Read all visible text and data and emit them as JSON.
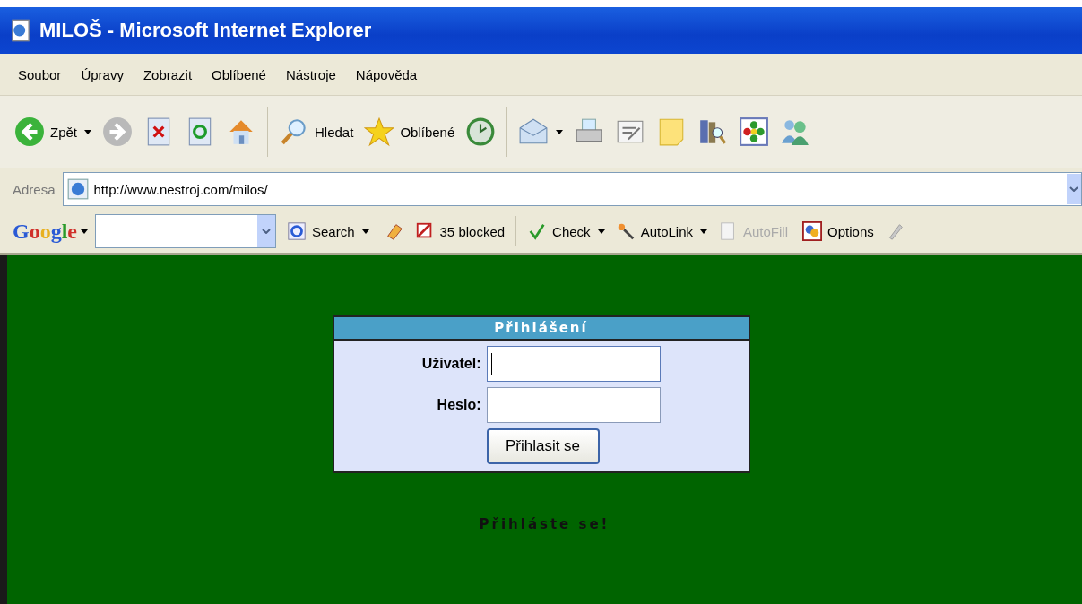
{
  "window": {
    "title": "MILOŠ - Microsoft Internet Explorer"
  },
  "menu": [
    "Soubor",
    "Úpravy",
    "Zobrazit",
    "Oblíbené",
    "Nástroje",
    "Nápověda"
  ],
  "toolbar": {
    "back_label": "Zpět",
    "forward_disabled": true,
    "search_label": "Hledat",
    "favorites_label": "Oblíbené"
  },
  "address": {
    "label": "Adresa",
    "url": "http://www.nestroj.com/milos/"
  },
  "google_toolbar": {
    "logo": "Google",
    "items": [
      {
        "label": "Search",
        "dropdown": true,
        "disabled": false
      },
      {
        "label": "35 blocked",
        "dropdown": false,
        "disabled": false
      },
      {
        "label": "Check",
        "dropdown": true,
        "disabled": false
      },
      {
        "label": "AutoLink",
        "dropdown": true,
        "disabled": false
      },
      {
        "label": "AutoFill",
        "dropdown": false,
        "disabled": true
      },
      {
        "label": "Options",
        "dropdown": false,
        "disabled": false
      }
    ]
  },
  "login": {
    "title": "Přihlášení",
    "fields": [
      {
        "label": "Uživatel:",
        "focused": true
      },
      {
        "label": "Heslo:",
        "focused": false
      }
    ],
    "button": "Přihlasit se"
  },
  "message": "Přihláste se!"
}
